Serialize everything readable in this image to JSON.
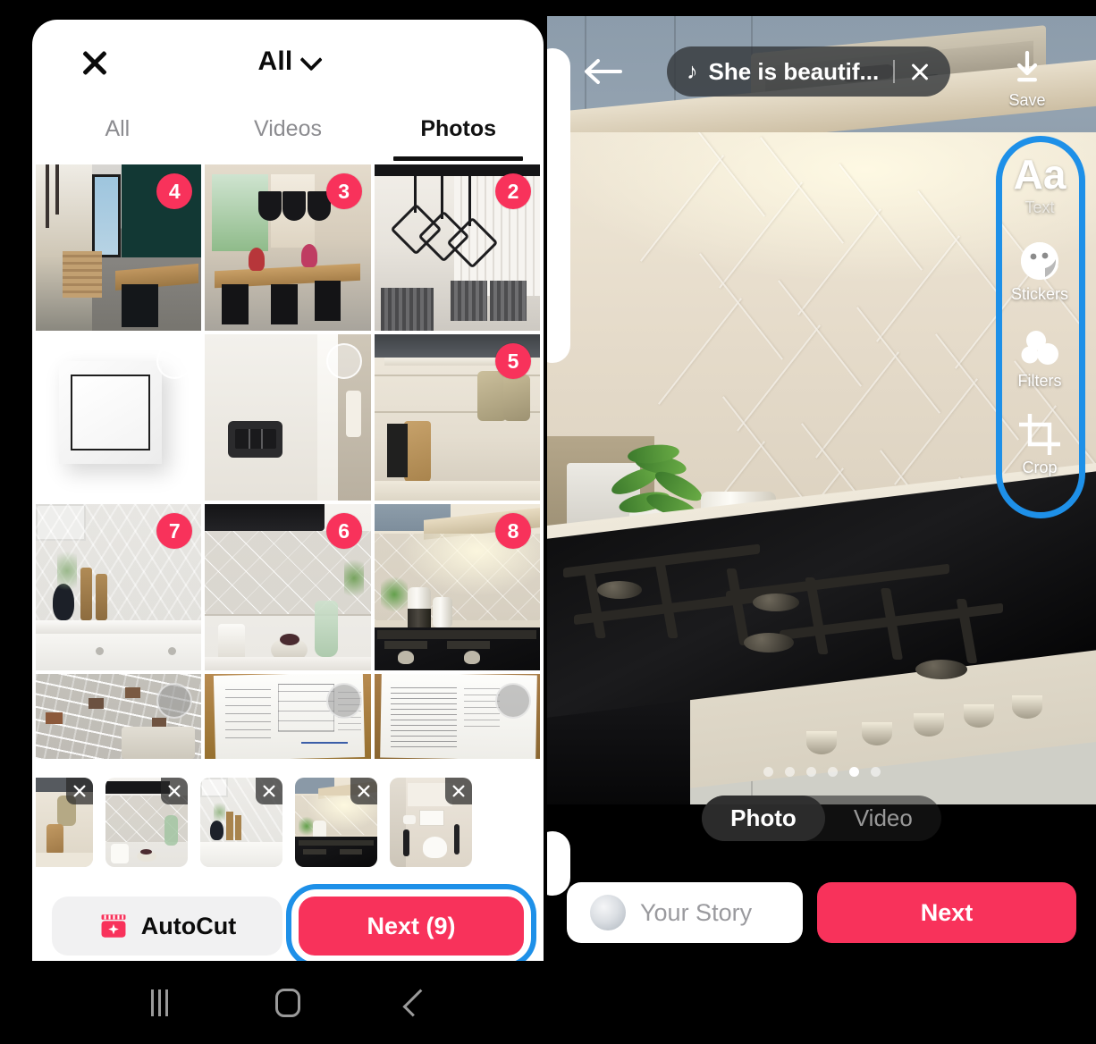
{
  "left_panel": {
    "close_icon": "close-x-icon",
    "album": {
      "label": "All",
      "chevron": "chevron-down-icon"
    },
    "tabs": [
      {
        "label": "All",
        "active": false
      },
      {
        "label": "Videos",
        "active": false
      },
      {
        "label": "Photos",
        "active": true
      }
    ],
    "grid": [
      {
        "name": "dining-room-dark-wall",
        "badge": "4",
        "selected": true
      },
      {
        "name": "dining-table-pendant-lamps",
        "badge": "3",
        "selected": true
      },
      {
        "name": "geometric-pendant-lights",
        "badge": "2",
        "selected": true
      },
      {
        "name": "white-wall-switch",
        "badge": "",
        "selected": false
      },
      {
        "name": "black-triple-switch-hallway",
        "badge": "",
        "selected": false
      },
      {
        "name": "kitchen-tiles-oven-mitts",
        "badge": "5",
        "selected": true
      },
      {
        "name": "herringbone-backsplash-vase",
        "badge": "7",
        "selected": true
      },
      {
        "name": "3d-diamond-tile-backsplash",
        "badge": "6",
        "selected": true
      },
      {
        "name": "gas-hob-backsplash",
        "badge": "8",
        "selected": true
      },
      {
        "name": "mosaic-tile-samples",
        "badge": "",
        "selected": false
      },
      {
        "name": "document-form-page",
        "badge": "",
        "selected": false
      },
      {
        "name": "document-text-page",
        "badge": "",
        "selected": false
      }
    ],
    "filmstrip": [
      {
        "name": "kitchen-tiles-oven-mitts-thumb",
        "remove_icon": "close-icon"
      },
      {
        "name": "3d-diamond-tile-thumb",
        "remove_icon": "close-icon"
      },
      {
        "name": "herringbone-vase-thumb",
        "remove_icon": "close-icon"
      },
      {
        "name": "gas-hob-thumb",
        "remove_icon": "close-icon"
      },
      {
        "name": "bathroom-thumb",
        "remove_icon": "close-icon"
      }
    ],
    "autocut_label": "AutoCut",
    "autocut_icon": "clapperboard-sparkle-icon",
    "next_label": "Next (9)",
    "highlight_color": "#1E90E8",
    "accent_color": "#F8325B"
  },
  "right_panel": {
    "back_icon": "arrow-left-icon",
    "music": {
      "note_icon": "music-note-icon",
      "title": "She is beautif...",
      "close_icon": "close-icon"
    },
    "save": {
      "label": "Save",
      "icon": "download-icon"
    },
    "tools": [
      {
        "label": "Text",
        "icon": "text-aa-icon",
        "glyph": "Aa"
      },
      {
        "label": "Stickers",
        "icon": "sticker-smiley-icon"
      },
      {
        "label": "Filters",
        "icon": "filters-circles-icon"
      },
      {
        "label": "Crop",
        "icon": "crop-icon"
      }
    ],
    "carousel": {
      "count": 6,
      "active_index": 4
    },
    "mode_toggle": [
      {
        "label": "Photo",
        "active": true
      },
      {
        "label": "Video",
        "active": false
      }
    ],
    "your_story": {
      "label": "Your Story",
      "avatar": "user-avatar"
    },
    "next_label": "Next",
    "highlight_color": "#1E90E8",
    "accent_color": "#F8325B"
  },
  "navbar": {
    "recents": "recents-icon",
    "home": "home-icon",
    "back": "back-icon"
  }
}
